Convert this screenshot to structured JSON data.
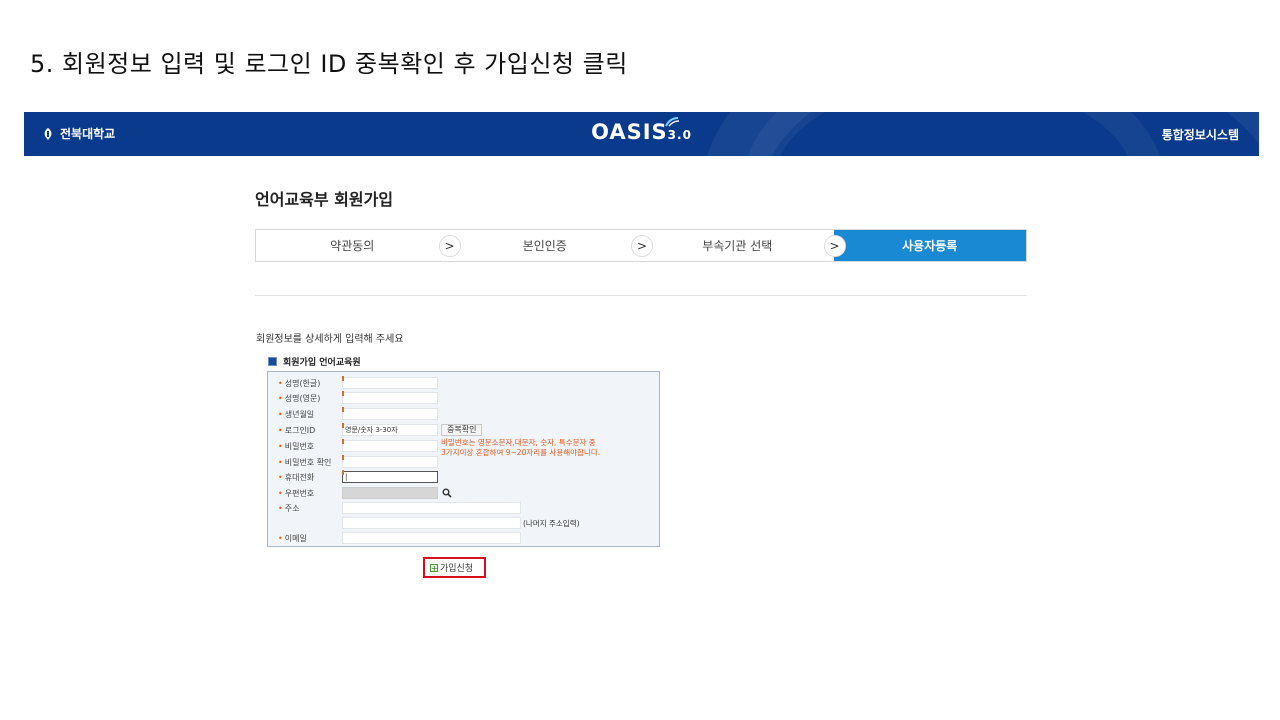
{
  "slide_title": "5. 회원정보 입력 및 로그인 ID 중복확인 후 가입신청 클릭",
  "header": {
    "university": "전북대학교",
    "brand": "OASIS",
    "brand_version": "3.0",
    "system_name": "통합정보시스템",
    "bg_color": "#0a3a8c"
  },
  "page_heading": "언어교육부 회원가입",
  "steps": [
    {
      "label": "약관동의",
      "active": false
    },
    {
      "label": "본인인증",
      "active": false
    },
    {
      "label": "부속기관 선택",
      "active": false
    },
    {
      "label": "사용자등록",
      "active": true
    }
  ],
  "steps_active_color": "#1989d3",
  "instructions": "회원정보를 상세하게 입력해 주세요",
  "form": {
    "title": "회원가입 언어교육원",
    "fields": {
      "name_kr": {
        "label": "성명(한글)",
        "value": ""
      },
      "name_en": {
        "label": "성명(영문)",
        "value": ""
      },
      "birth": {
        "label": "생년월일",
        "value": ""
      },
      "login_id": {
        "label": "로그인ID",
        "placeholder": "영문/숫자 3-30자"
      },
      "password": {
        "label": "비밀번호",
        "value": ""
      },
      "password_confirm": {
        "label": "비밀번호 확인",
        "value": ""
      },
      "mobile": {
        "label": "휴대전화",
        "value": "|"
      },
      "postcode": {
        "label": "우편번호",
        "value": ""
      },
      "address": {
        "label": "주소",
        "value": ""
      },
      "address_detail_note": "(나머지 주소입력)",
      "email": {
        "label": "이메일",
        "value": ""
      }
    },
    "dup_check_button": "중복확인",
    "password_note_line1": "비밀번호는 영문소문자,대문자, 숫자, 특수문자 중",
    "password_note_line2": "3가지이상 혼합하여 9~20자리를 사용해야합니다.",
    "password_note_color": "#e05a1a"
  },
  "submit_button": "가입신청",
  "highlight_color": "#d3101b"
}
